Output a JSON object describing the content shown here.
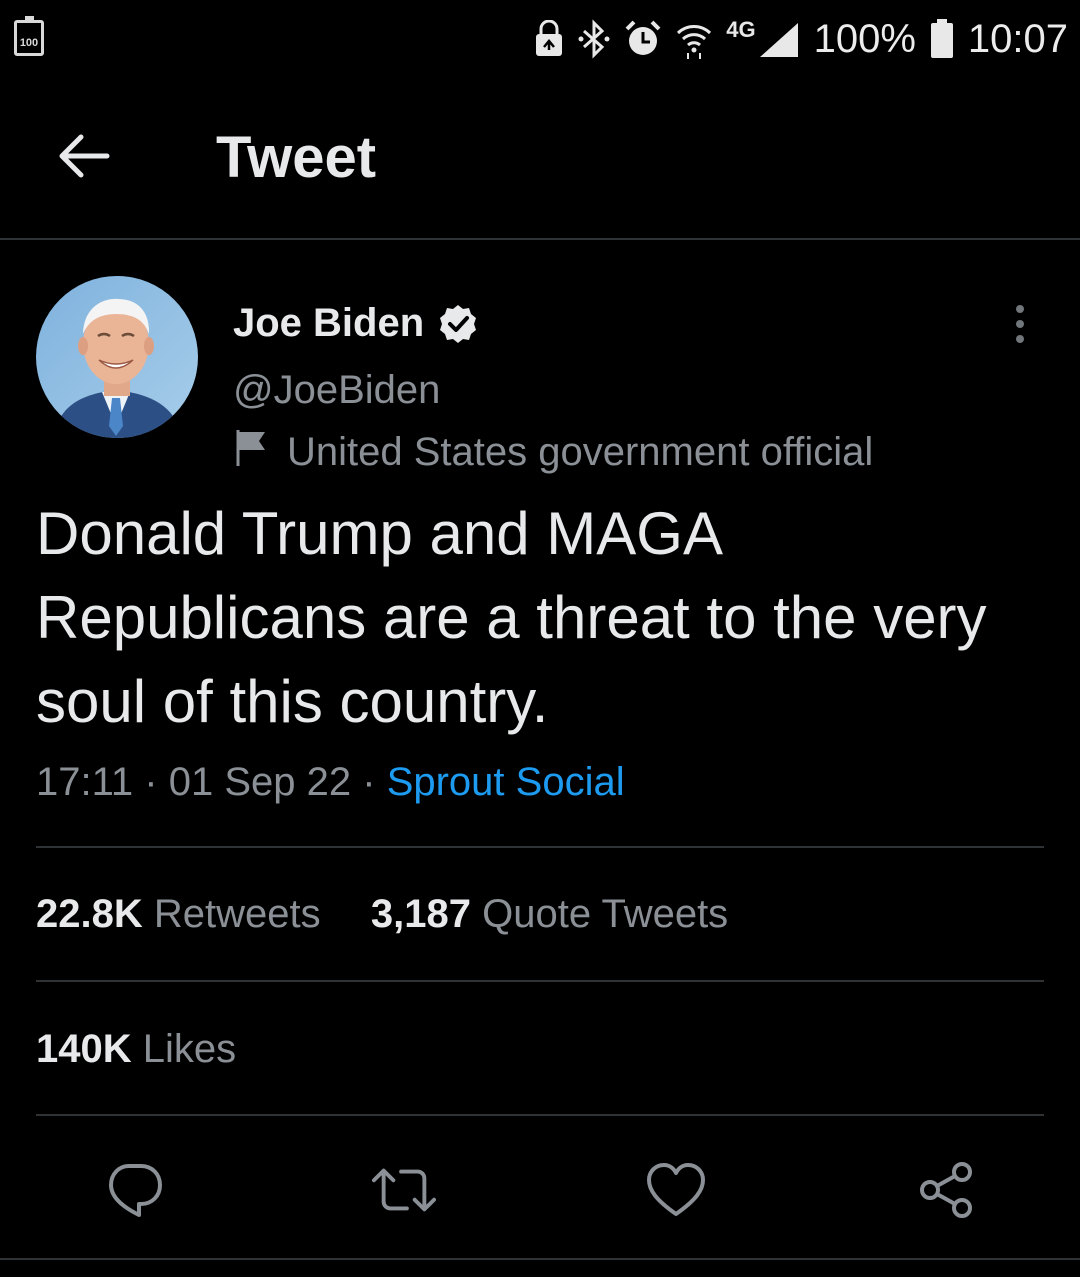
{
  "status_bar": {
    "battery_badge": "100",
    "battery_percent": "100%",
    "network": "4G",
    "time": "10:07"
  },
  "header": {
    "title": "Tweet"
  },
  "tweet": {
    "author_name": "Joe Biden",
    "handle": "@JoeBiden",
    "label": "United States government official",
    "text": "Donald Trump and MAGA Republicans are a threat to the very soul of this country.",
    "time": "17:11",
    "date": "01 Sep 22",
    "separator": "·",
    "source": "Sprout Social"
  },
  "stats": {
    "retweets_count": "22.8K",
    "retweets_label": "Retweets",
    "quotes_count": "3,187",
    "quotes_label": "Quote Tweets",
    "likes_count": "140K",
    "likes_label": "Likes"
  },
  "colors": {
    "background": "#000000",
    "link": "#1d9bf0",
    "muted": "#8b9096",
    "divider": "#2f3336"
  },
  "icons": [
    "back-arrow-icon",
    "verified-badge-icon",
    "flag-icon",
    "more-vertical-icon",
    "reply-icon",
    "retweet-icon",
    "like-icon",
    "share-icon"
  ]
}
